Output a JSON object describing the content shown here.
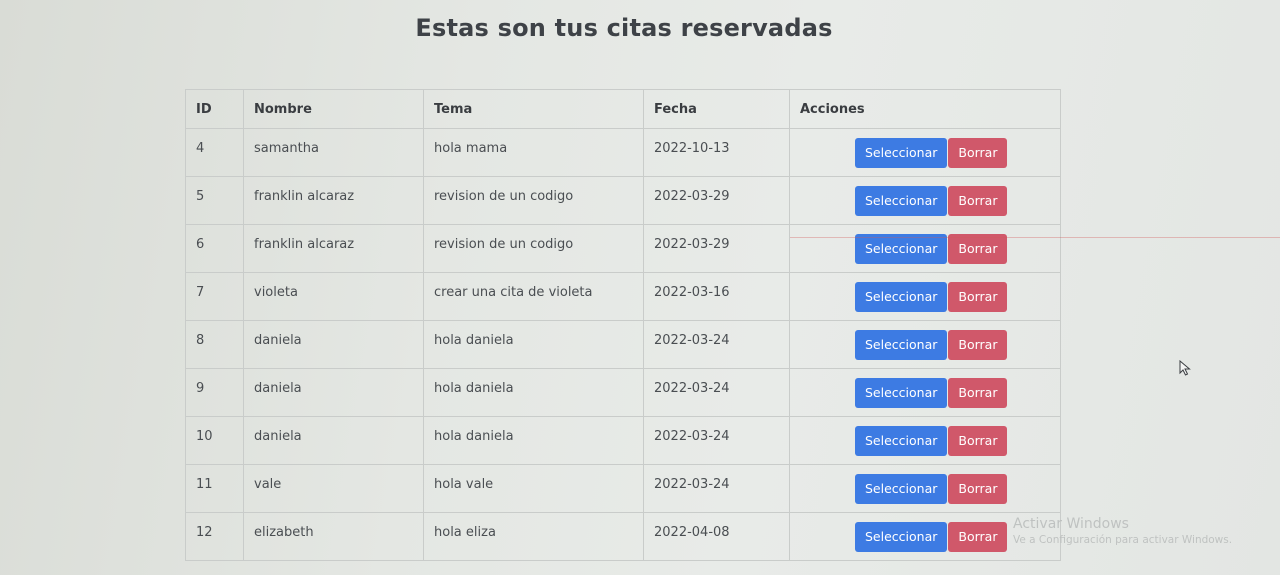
{
  "page": {
    "title": "Estas son tus citas reservadas"
  },
  "table": {
    "headers": [
      "ID",
      "Nombre",
      "Tema",
      "Fecha",
      "Acciones"
    ],
    "rows": [
      {
        "id": "4",
        "nombre": "samantha",
        "tema": "hola mama",
        "fecha": "2022-10-13"
      },
      {
        "id": "5",
        "nombre": "franklin alcaraz",
        "tema": "revision de un codigo",
        "fecha": "2022-03-29"
      },
      {
        "id": "6",
        "nombre": "franklin alcaraz",
        "tema": "revision de un codigo",
        "fecha": "2022-03-29"
      },
      {
        "id": "7",
        "nombre": "violeta",
        "tema": "crear una cita de violeta",
        "fecha": "2022-03-16"
      },
      {
        "id": "8",
        "nombre": "daniela",
        "tema": "hola daniela",
        "fecha": "2022-03-24"
      },
      {
        "id": "9",
        "nombre": "daniela",
        "tema": "hola daniela",
        "fecha": "2022-03-24"
      },
      {
        "id": "10",
        "nombre": "daniela",
        "tema": "hola daniela",
        "fecha": "2022-03-24"
      },
      {
        "id": "11",
        "nombre": "vale",
        "tema": "hola vale",
        "fecha": "2022-03-24"
      },
      {
        "id": "12",
        "nombre": "elizabeth",
        "tema": "hola eliza",
        "fecha": "2022-04-08"
      }
    ],
    "actions": {
      "select_label": "Seleccionar",
      "delete_label": "Borrar"
    }
  },
  "watermark": {
    "title": "Activar Windows",
    "subtitle": "Ve a Configuración para activar Windows."
  },
  "colors": {
    "select_button": "#3d7be3",
    "delete_button": "#d0586a"
  },
  "icons": {
    "cursor": "mouse-pointer-icon"
  }
}
